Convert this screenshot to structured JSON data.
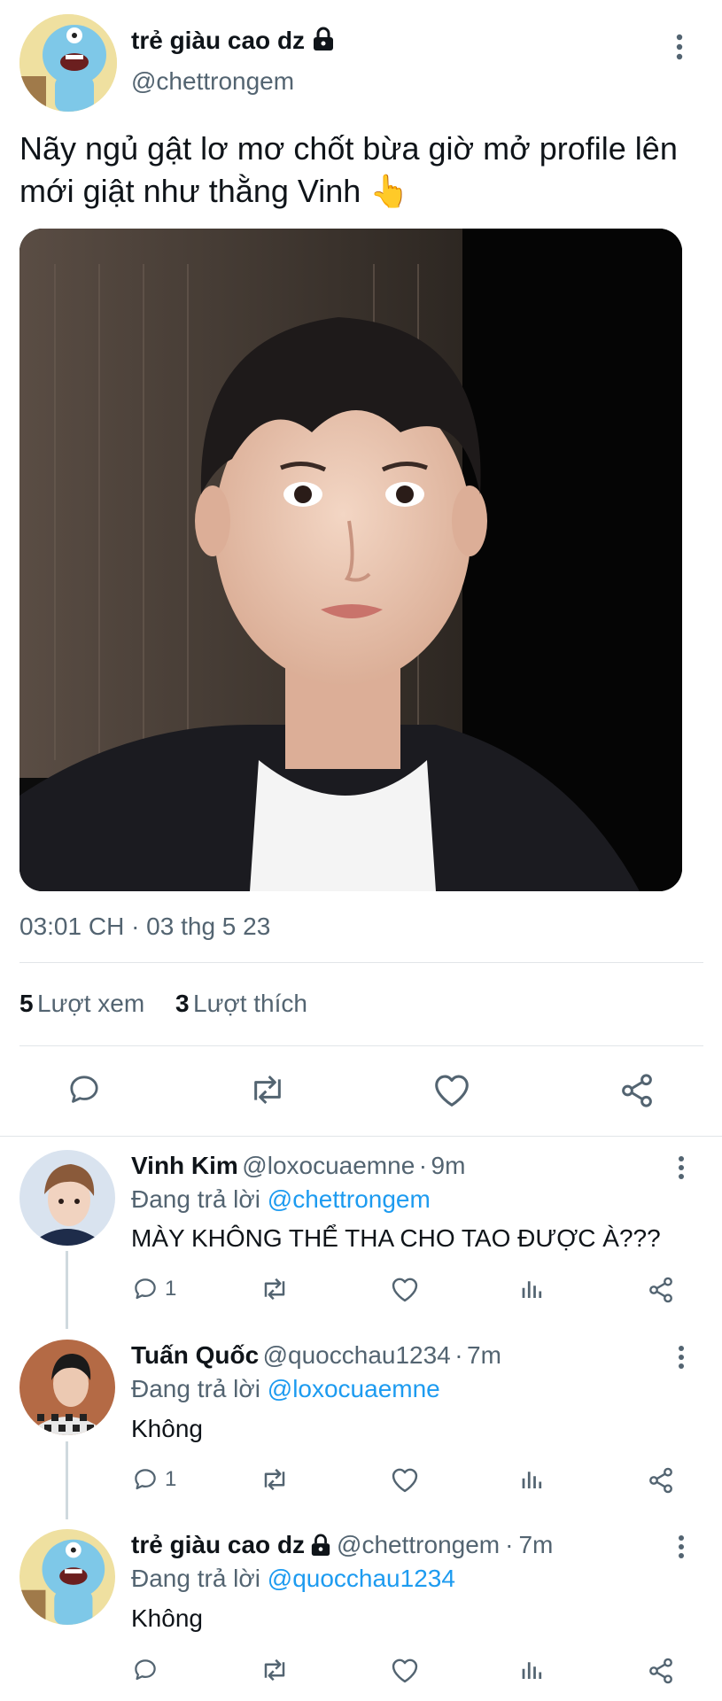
{
  "colors": {
    "text": "#0f1419",
    "muted": "#536471",
    "link": "#1d9bf0",
    "border": "#e1e5e8",
    "icon": "#536471"
  },
  "main": {
    "author_name": "trẻ giàu cao dz",
    "author_locked_icon": "lock-icon",
    "author_handle": "@chettrongem",
    "text_line1": "Nãy ngủ gật lơ mơ chốt bừa giờ mở profile lên",
    "text_line2": "mới giật như thằng Vinh",
    "emoji": "👆",
    "timestamp": "03:01 CH · 03 thg 5 23",
    "views_count": "5",
    "views_label": "Lượt xem",
    "likes_count": "3",
    "likes_label": "Lượt thích",
    "actions": [
      "reply-icon",
      "retweet-icon",
      "like-icon",
      "share-icon"
    ]
  },
  "replies": [
    {
      "name": "Vinh Kim",
      "handle": "@loxocuaemne",
      "sep": "·",
      "time": "9m",
      "replying_prefix": "Đang trả lời",
      "replying_to": "@chettrongem",
      "text": "MÀY KHÔNG THỂ THA CHO TAO ĐƯỢC À???",
      "reply_count": "1"
    },
    {
      "name": "Tuấn Quốc",
      "handle": "@quocchau1234",
      "sep": "·",
      "time": "7m",
      "replying_prefix": "Đang trả lời",
      "replying_to": "@loxocuaemne",
      "text": "Không",
      "reply_count": "1"
    },
    {
      "name": "trẻ giàu cao dz",
      "handle": "@chettrongem",
      "sep": "·",
      "time": "7m",
      "replying_prefix": "Đang trả lời",
      "replying_to": "@quocchau1234",
      "text": "Không",
      "reply_count": ""
    }
  ]
}
